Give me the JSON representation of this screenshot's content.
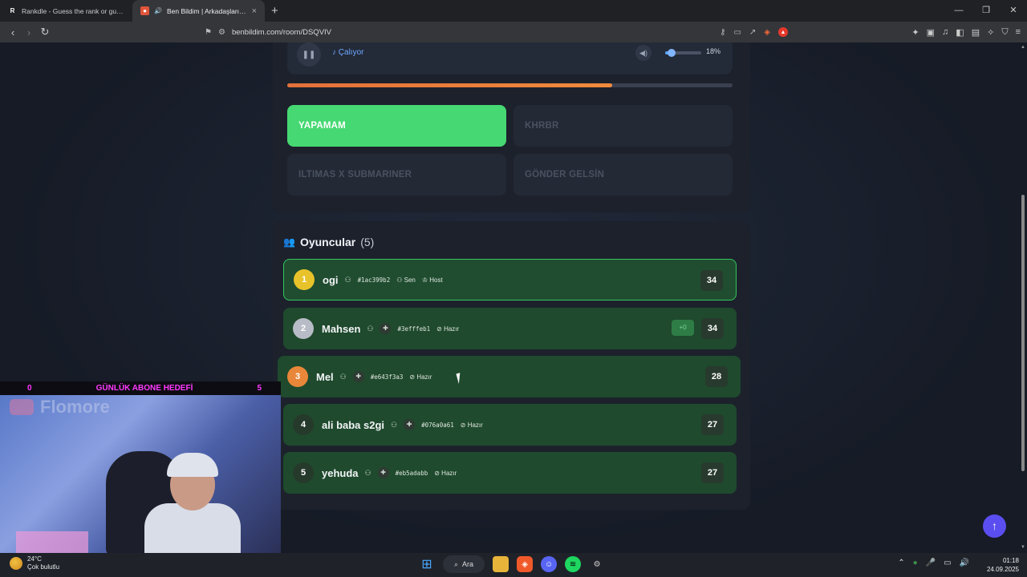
{
  "browser": {
    "tabs": [
      {
        "title": "Rankdle - Guess the rank or guess the...",
        "favicon": "R",
        "active": false
      },
      {
        "title": "Ben Bildim | Arkadaşlarınla Oyna",
        "favicon": "B",
        "active": true
      }
    ],
    "url": "benbildim.com/room/DSQVIV"
  },
  "player": {
    "status_label": "Çalıyor",
    "volume_percent": 18,
    "volume_label": "18%",
    "progress": 0.73
  },
  "answers": [
    {
      "label": "YAPAMAM",
      "state": "correct"
    },
    {
      "label": "KHRBR",
      "state": "disabled"
    },
    {
      "label": "ILTIMAS X SUBMARINER",
      "state": "disabled"
    },
    {
      "label": "GÖNDER GELSİN",
      "state": "disabled"
    }
  ],
  "players_section": {
    "title": "Oyuncular",
    "count": "(5)",
    "players": [
      {
        "rank": "1",
        "name": "ogi",
        "code": "#1ac399b2",
        "tag1": "Sen",
        "tag2": "Host",
        "score": "34",
        "delta": "",
        "rank_color": "#e8c22a"
      },
      {
        "rank": "2",
        "name": "Mahsen",
        "code": "#3efffeb1",
        "tag1": "Hazır",
        "tag2": "",
        "score": "34",
        "delta": "+0",
        "rank_color": "#b8bcc6"
      },
      {
        "rank": "3",
        "name": "Mel",
        "code": "#e643f3a3",
        "tag1": "Hazır",
        "tag2": "",
        "score": "28",
        "delta": "",
        "rank_color": "#e8873a"
      },
      {
        "rank": "4",
        "name": "ali baba s2gi",
        "code": "#076a0a61",
        "tag1": "Hazır",
        "tag2": "",
        "score": "27",
        "delta": "",
        "rank_color": "#2a3a2e"
      },
      {
        "rank": "5",
        "name": "yehuda",
        "code": "#eb5adabb",
        "tag1": "Hazır",
        "tag2": "",
        "score": "27",
        "delta": "",
        "rank_color": "#2a3a2e"
      }
    ]
  },
  "overlay": {
    "left_count": "0",
    "goal_text": "GÜNLÜK ABONE HEDEFİ",
    "right_count": "5",
    "brand": "Flomore"
  },
  "taskbar": {
    "temperature": "24°C",
    "weather": "Çok bulutlu",
    "search": "Ara",
    "time": "01:18",
    "date": "24.09.2025"
  }
}
